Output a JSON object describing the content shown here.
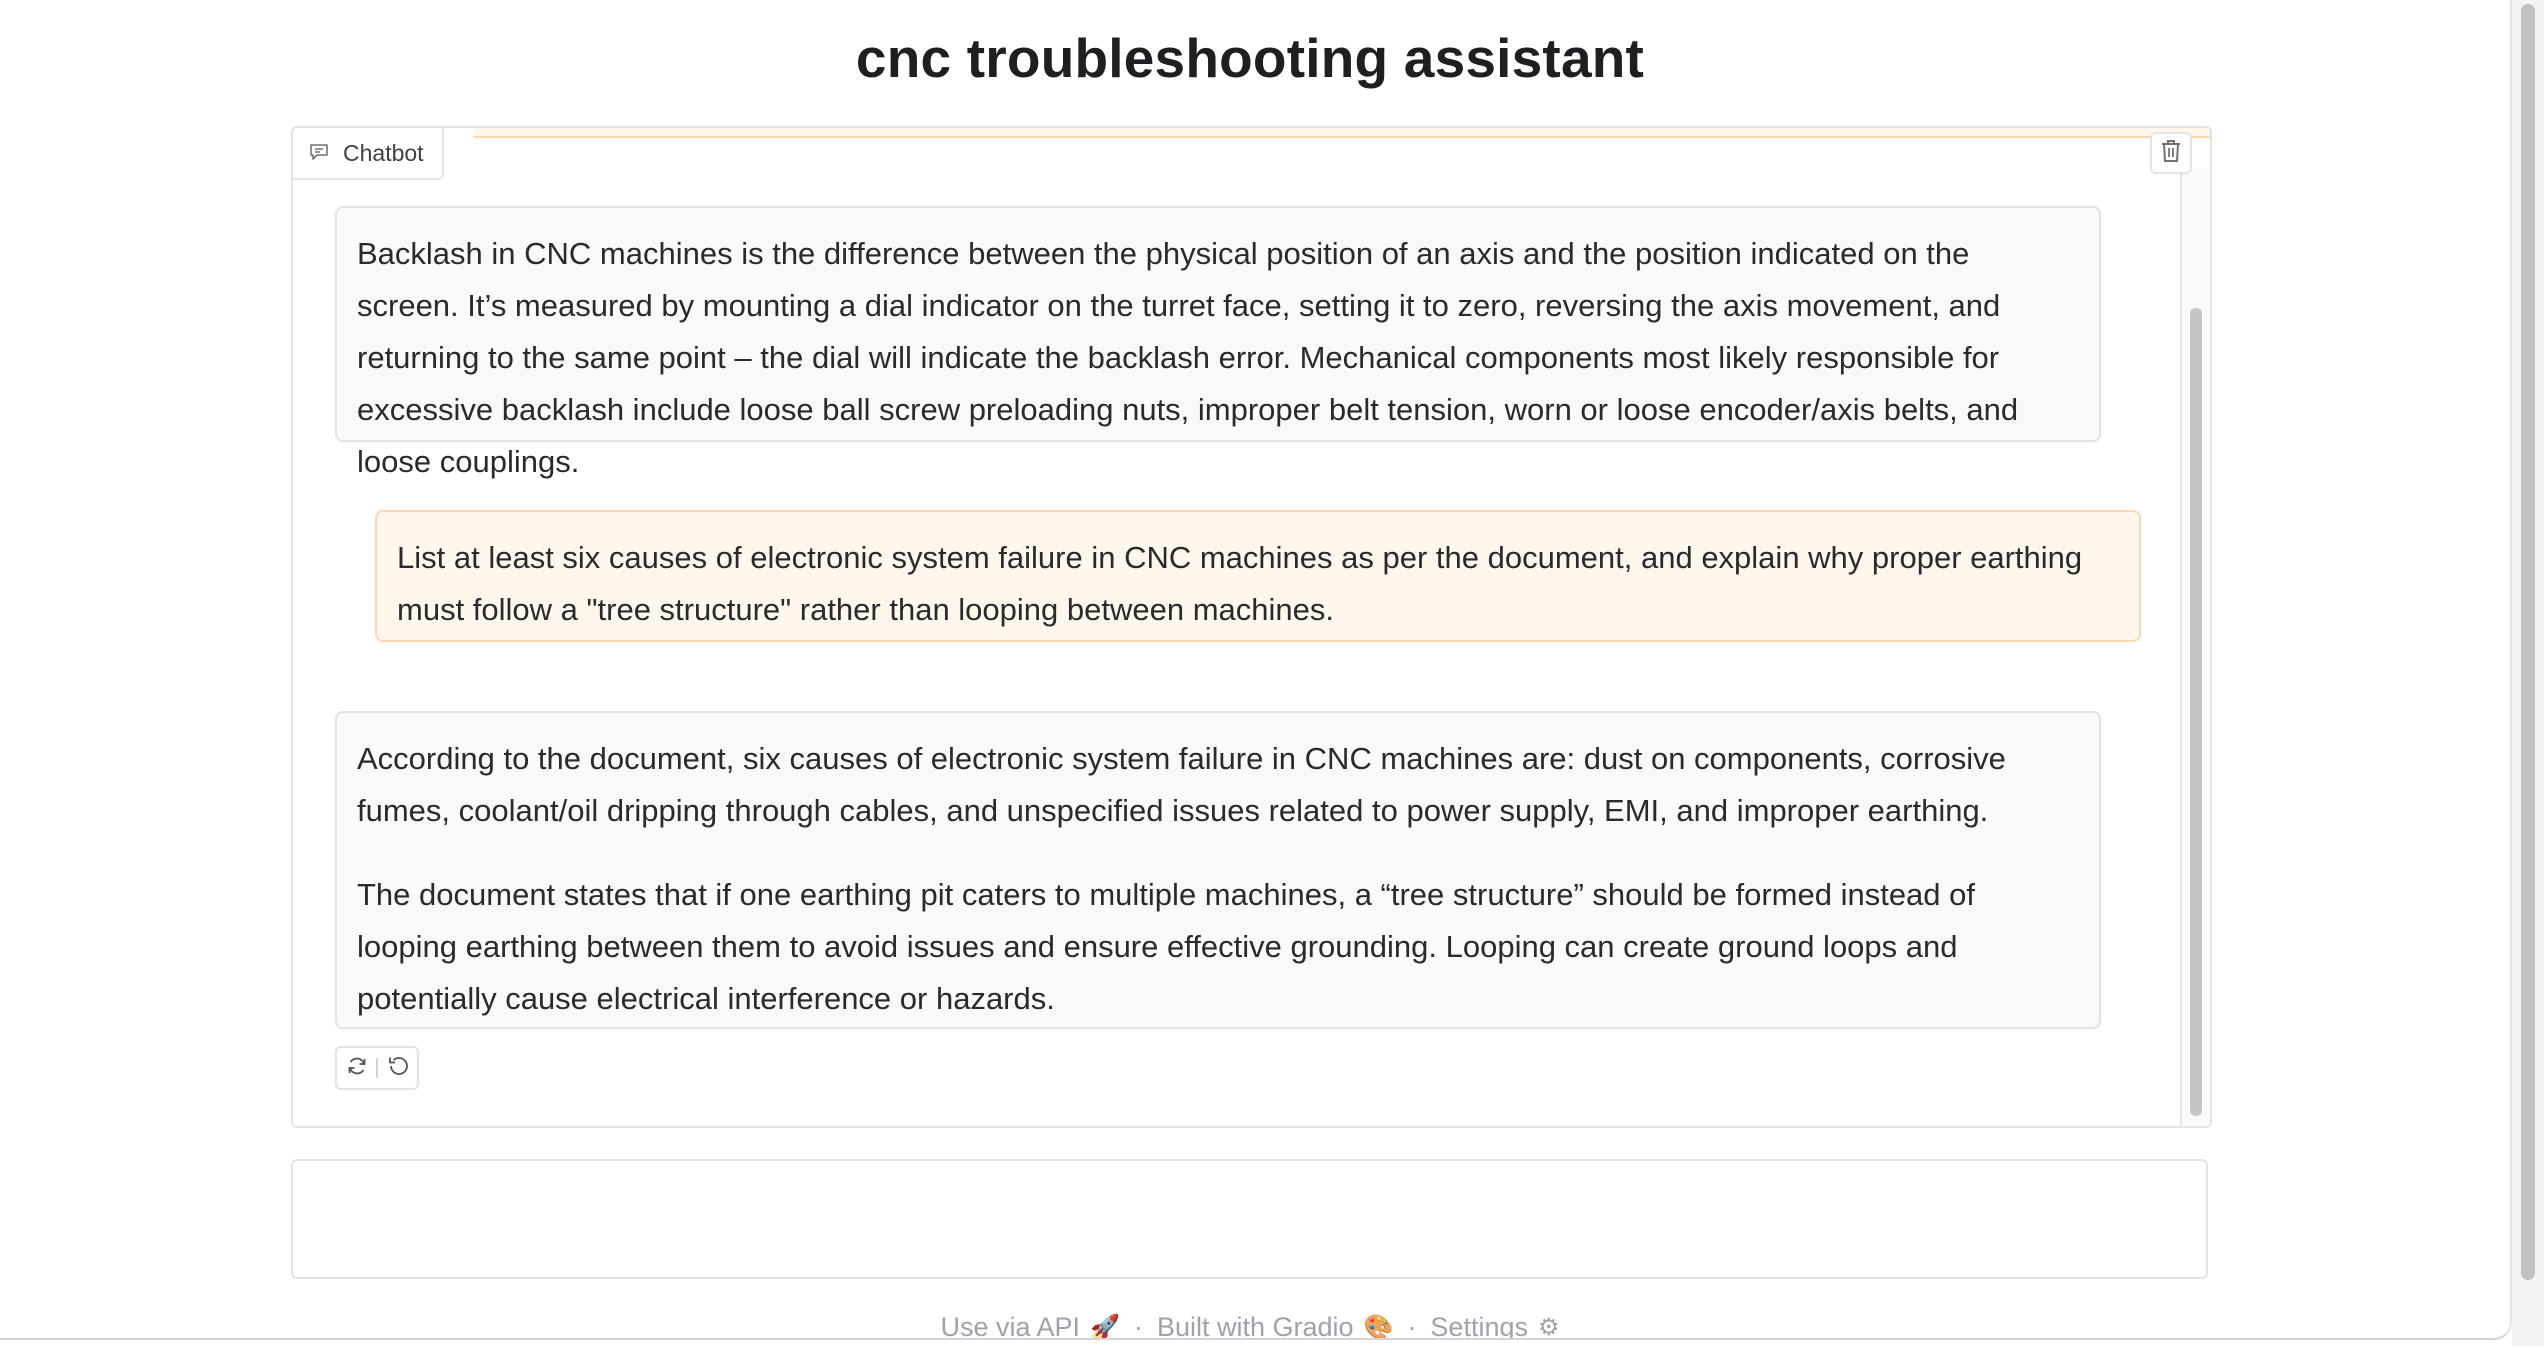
{
  "page": {
    "title": "cnc troubleshooting assistant"
  },
  "chatbot": {
    "label": "Chatbot",
    "messages": [
      {
        "role": "bot",
        "paragraphs": [
          "Backlash in CNC machines is the difference between the physical position of an axis and the position indicated on the screen. It’s measured by mounting a dial indicator on the turret face, setting it to zero, reversing the axis movement, and returning to the same point – the dial will indicate the backlash error. Mechanical components most likely responsible for excessive backlash include loose ball screw preloading nuts, improper belt tension, worn or loose encoder/axis belts, and loose couplings."
        ]
      },
      {
        "role": "user",
        "paragraphs": [
          "List at least six causes of electronic system failure in CNC machines as per the document, and explain why proper earthing must follow a \"tree structure\" rather than looping between machines."
        ]
      },
      {
        "role": "bot",
        "paragraphs": [
          "According to the document, six causes of electronic system failure in CNC machines are: dust on components, corrosive fumes, coolant/oil dripping through cables, and unspecified issues related to power supply, EMI, and improper earthing.",
          "The document states that if one earthing pit caters to multiple machines, a “tree structure” should be formed instead of looping earthing between them to avoid issues and ensure effective grounding. Looping can create ground loops and potentially cause electrical interference or hazards."
        ]
      }
    ],
    "actions": {
      "retry_icon": "retry-icon",
      "undo_icon": "undo-icon"
    },
    "clear_icon": "trash-icon"
  },
  "input": {
    "value": "",
    "placeholder": ""
  },
  "footer": {
    "api_label": "Use via API",
    "api_emoji": "🚀",
    "gradio_label": "Built with Gradio",
    "gradio_emoji": "🎨",
    "settings_label": "Settings",
    "settings_emoji": "⚙",
    "separator": "·"
  },
  "colors": {
    "user_bubble_bg": "#fff7ec",
    "user_bubble_border": "#fbd7b0",
    "bot_bubble_bg": "#f9f9fa",
    "border": "#e4e4e7"
  }
}
